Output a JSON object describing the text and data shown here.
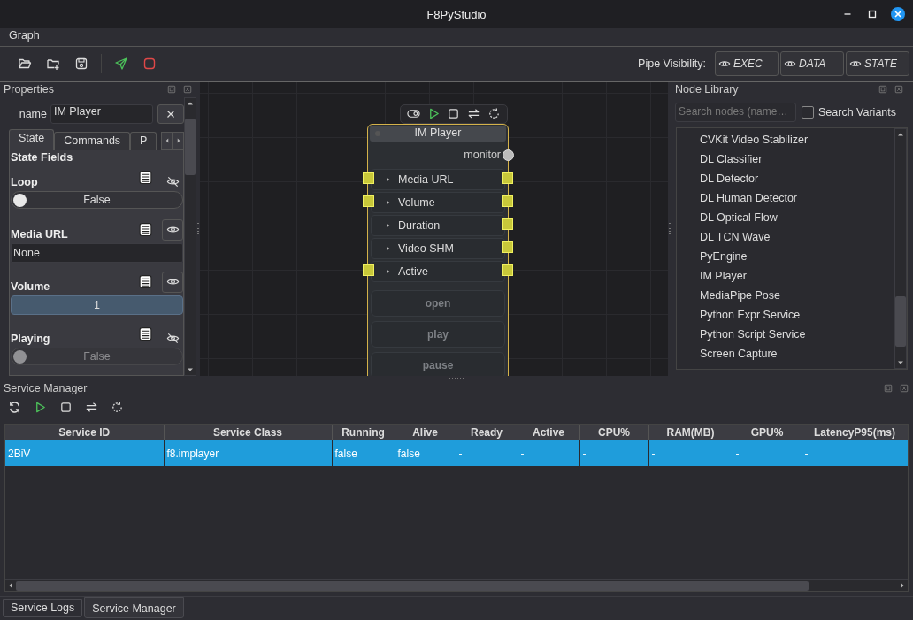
{
  "window": {
    "title": "F8PyStudio"
  },
  "menu": [
    "Graph"
  ],
  "toolbar": {
    "pipe_visibility_label": "Pipe Visibility:",
    "pipe_toggles": [
      "EXEC",
      "DATA",
      "STATE"
    ]
  },
  "properties": {
    "title": "Properties",
    "name_label": "name",
    "name_value": "IM Player",
    "tabs": [
      {
        "label": "State",
        "selected": true
      },
      {
        "label": "Commands",
        "selected": false
      },
      {
        "label": "P",
        "selected": false
      }
    ],
    "section": "State Fields",
    "fields": [
      {
        "label": "Loop",
        "kind": "toggle",
        "value": "False",
        "checked": false,
        "disabled": false,
        "visible": false
      },
      {
        "label": "Media URL",
        "kind": "text",
        "value": "None",
        "visible": true
      },
      {
        "label": "Volume",
        "kind": "number",
        "value": "1",
        "visible": true
      },
      {
        "label": "Playing",
        "kind": "toggle",
        "value": "False",
        "checked": false,
        "disabled": true,
        "visible": false
      }
    ]
  },
  "graph": {
    "node": {
      "title": "IM Player",
      "monitor_label": "monitor",
      "ports": [
        {
          "label": "Media URL",
          "input": true,
          "output": true
        },
        {
          "label": "Volume",
          "input": true,
          "output": true
        },
        {
          "label": "Duration",
          "input": false,
          "output": true
        },
        {
          "label": "Video SHM",
          "input": false,
          "output": true
        },
        {
          "label": "Active",
          "input": true,
          "output": true
        }
      ],
      "commands": [
        "open",
        "play",
        "pause"
      ]
    }
  },
  "node_library": {
    "title": "Node Library",
    "search_placeholder": "Search nodes (name…",
    "search_variants": {
      "label": "Search Variants",
      "checked": false
    },
    "items": [
      "CVKit Video Stabilizer",
      "DL Classifier",
      "DL Detector",
      "DL Human Detector",
      "DL Optical Flow",
      "DL TCN Wave",
      "PyEngine",
      "IM Player",
      "MediaPipe Pose",
      "Python Expr Service",
      "Python Script Service",
      "Screen Capture"
    ]
  },
  "service_manager": {
    "title": "Service Manager",
    "table": {
      "columns": [
        "Service ID",
        "Service Class",
        "Running",
        "Alive",
        "Ready",
        "Active",
        "CPU%",
        "RAM(MB)",
        "GPU%",
        "LatencyP95(ms)"
      ],
      "rows": [
        {
          "cells": [
            "2BiV",
            "f8.implayer",
            "false",
            "false",
            "-",
            "-",
            "-",
            "-",
            "-",
            "-"
          ],
          "selected": true
        }
      ]
    }
  },
  "bottom_tabs": [
    {
      "label": "Service Logs",
      "selected": false
    },
    {
      "label": "Service Manager",
      "selected": true
    }
  ]
}
